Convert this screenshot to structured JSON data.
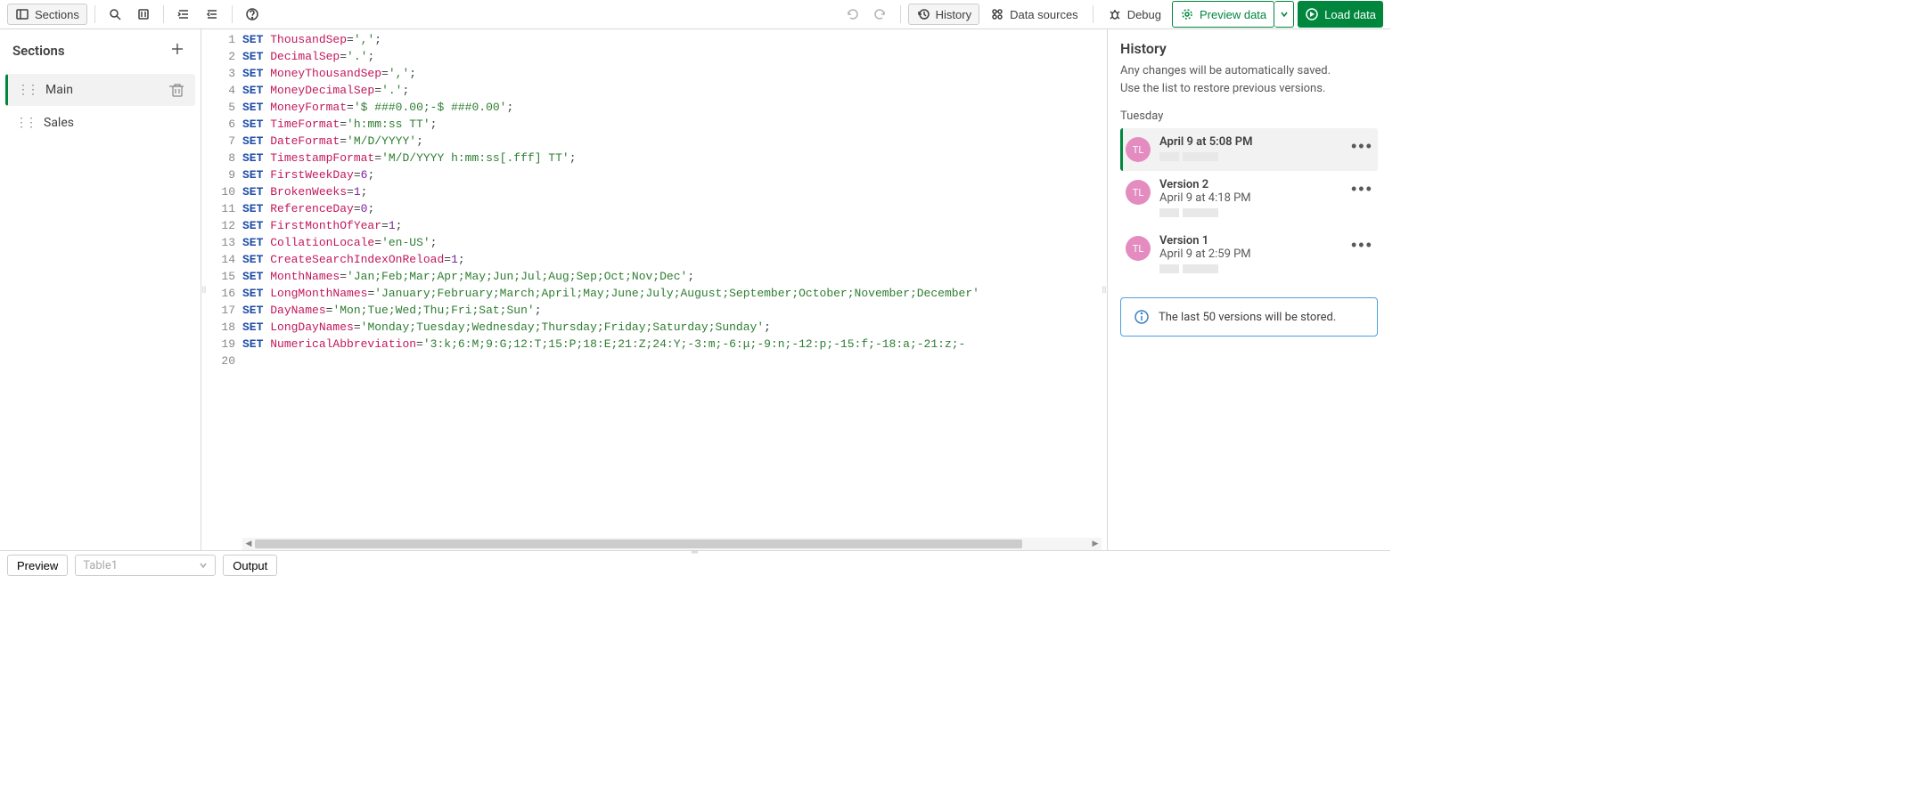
{
  "toolbar": {
    "sections_label": "Sections",
    "history_label": "History",
    "data_sources_label": "Data sources",
    "debug_label": "Debug",
    "preview_data_label": "Preview data",
    "load_data_label": "Load data"
  },
  "sections": {
    "title": "Sections",
    "items": [
      {
        "label": "Main",
        "active": true
      },
      {
        "label": "Sales",
        "active": false
      }
    ]
  },
  "editor": {
    "lines": [
      {
        "n": 1,
        "var": "ThousandSep",
        "op": "=",
        "val": "','",
        "tail": ";"
      },
      {
        "n": 2,
        "var": "DecimalSep",
        "op": "=",
        "val": "'.'",
        "tail": ";"
      },
      {
        "n": 3,
        "var": "MoneyThousandSep",
        "op": "=",
        "val": "','",
        "tail": ";"
      },
      {
        "n": 4,
        "var": "MoneyDecimalSep",
        "op": "=",
        "val": "'.'",
        "tail": ";"
      },
      {
        "n": 5,
        "var": "MoneyFormat",
        "op": "=",
        "val": "'$ ###0.00;-$ ###0.00'",
        "tail": ";"
      },
      {
        "n": 6,
        "var": "TimeFormat",
        "op": "=",
        "val": "'h:mm:ss TT'",
        "tail": ";"
      },
      {
        "n": 7,
        "var": "DateFormat",
        "op": "=",
        "val": "'M/D/YYYY'",
        "tail": ";"
      },
      {
        "n": 8,
        "var": "TimestampFormat",
        "op": "=",
        "val": "'M/D/YYYY h:mm:ss[.fff] TT'",
        "tail": ";"
      },
      {
        "n": 9,
        "var": "FirstWeekDay",
        "op": "=",
        "num": "6",
        "tail": ";"
      },
      {
        "n": 10,
        "var": "BrokenWeeks",
        "op": "=",
        "num": "1",
        "tail": ";"
      },
      {
        "n": 11,
        "var": "ReferenceDay",
        "op": "=",
        "num": "0",
        "tail": ";"
      },
      {
        "n": 12,
        "var": "FirstMonthOfYear",
        "op": "=",
        "num": "1",
        "tail": ";"
      },
      {
        "n": 13,
        "var": "CollationLocale",
        "op": "=",
        "val": "'en-US'",
        "tail": ";"
      },
      {
        "n": 14,
        "var": "CreateSearchIndexOnReload",
        "op": "=",
        "num": "1",
        "tail": ";"
      },
      {
        "n": 15,
        "var": "MonthNames",
        "op": "=",
        "val": "'Jan;Feb;Mar;Apr;May;Jun;Jul;Aug;Sep;Oct;Nov;Dec'",
        "tail": ";"
      },
      {
        "n": 16,
        "var": "LongMonthNames",
        "op": "=",
        "val": "'January;February;March;April;May;June;July;August;September;October;November;December'",
        "tail": ""
      },
      {
        "n": 17,
        "var": "DayNames",
        "op": "=",
        "val": "'Mon;Tue;Wed;Thu;Fri;Sat;Sun'",
        "tail": ";"
      },
      {
        "n": 18,
        "var": "LongDayNames",
        "op": "=",
        "val": "'Monday;Tuesday;Wednesday;Thursday;Friday;Saturday;Sunday'",
        "tail": ";"
      },
      {
        "n": 19,
        "var": "NumericalAbbreviation",
        "op": "=",
        "val": "'3:k;6:M;9:G;12:T;15:P;18:E;21:Z;24:Y;-3:m;-6:μ;-9:n;-12:p;-15:f;-18:a;-21:z;-",
        "tail": ""
      },
      {
        "n": 20,
        "blank": true
      }
    ],
    "kw": "SET"
  },
  "history": {
    "title": "History",
    "desc1": "Any changes will be automatically saved.",
    "desc2": "Use the list to restore previous versions.",
    "day": "Tuesday",
    "items": [
      {
        "title": "April 9 at 5:08 PM",
        "time": "",
        "initials": "TL",
        "active": true
      },
      {
        "title": "Version 2",
        "time": "April 9 at 4:18 PM",
        "initials": "TL",
        "active": false
      },
      {
        "title": "Version 1",
        "time": "April 9 at 2:59 PM",
        "initials": "TL",
        "active": false
      }
    ],
    "banner": "The last 50 versions will be stored."
  },
  "bottom": {
    "preview_label": "Preview",
    "table_placeholder": "Table1",
    "output_label": "Output"
  }
}
